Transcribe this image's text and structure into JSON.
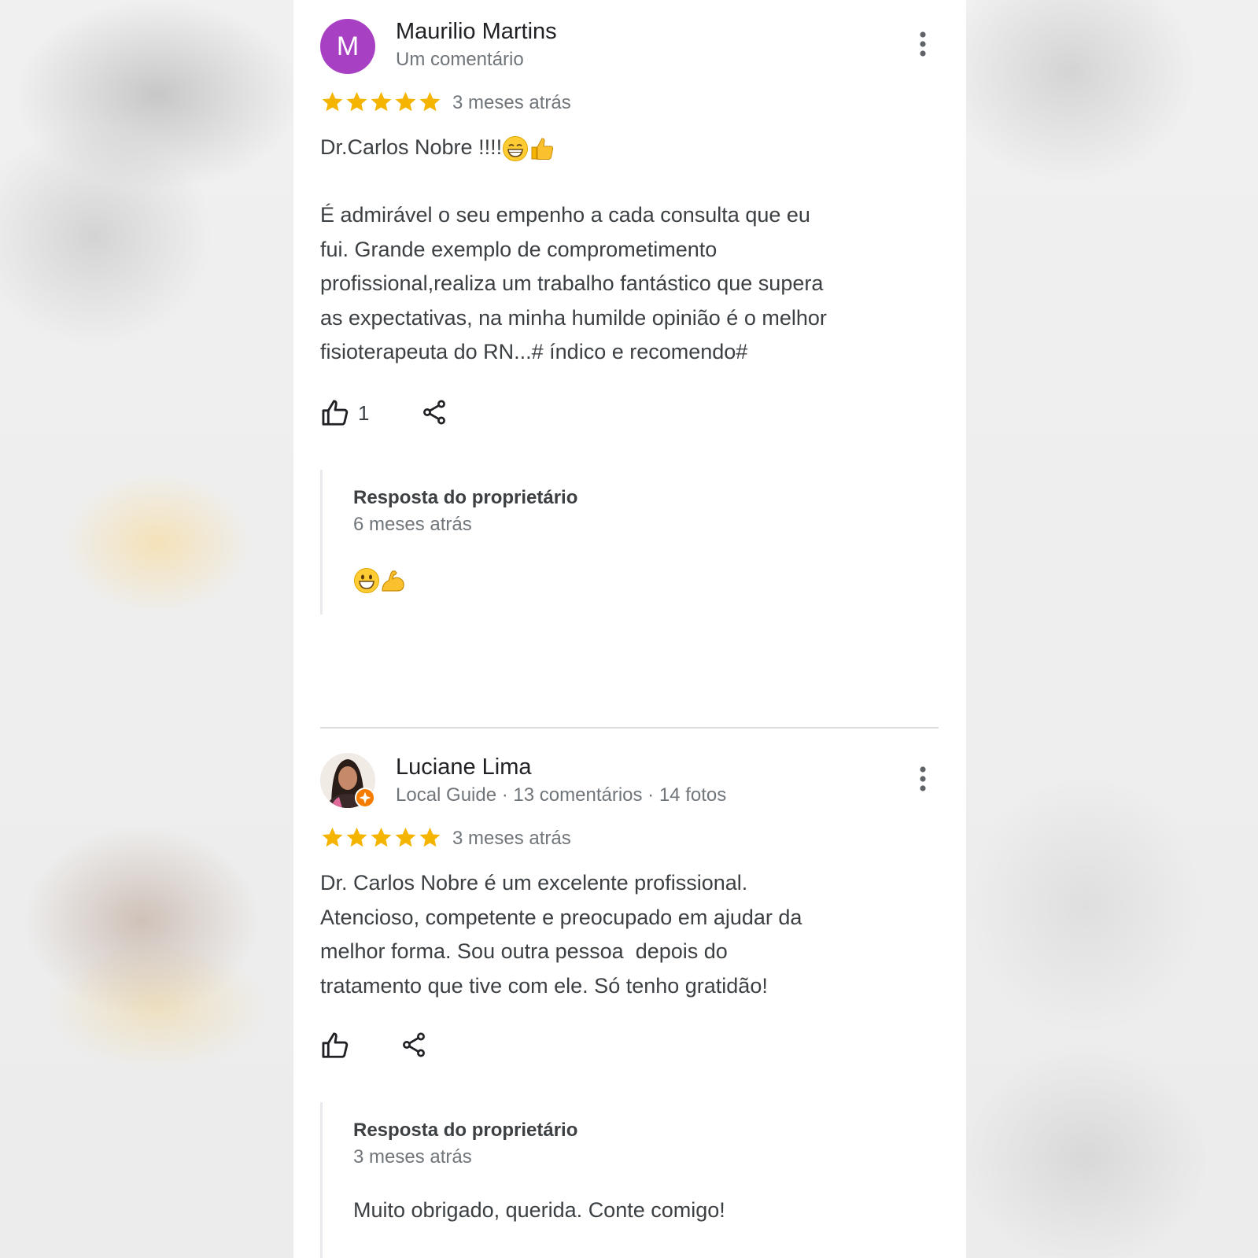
{
  "reviews": [
    {
      "avatar_letter": "M",
      "avatar_color": "#a840c4",
      "name": "Maurilio Martins",
      "meta": "Um comentário",
      "rating": 5,
      "date": "3 meses atrás",
      "text_line1": "Dr.Carlos Nobre !!!!",
      "text_line1_emojis": [
        "grinning-face-with-smiling-eyes-emoji",
        "thumbs-up-emoji"
      ],
      "text_body": "É admirável o seu empenho a cada consulta que eu\nfui. Grande exemplo de comprometimento\nprofissional,realiza um trabalho fantástico que supera\nas expectativas, na minha humilde opinião é o melhor\nfisioterapeuta do RN...# índico e recomendo#",
      "like_count": "1",
      "owner_reply": {
        "title": "Resposta do proprietário",
        "date": "6 meses atrás",
        "emojis": [
          "grinning-face-emoji",
          "flexed-biceps-emoji"
        ]
      }
    },
    {
      "avatar_badge": "local-guide-badge-icon",
      "name": "Luciane Lima",
      "meta": "Local Guide · 13 comentários · 14 fotos",
      "rating": 5,
      "date": "3 meses atrás",
      "text_body": "Dr. Carlos Nobre é um excelente profissional.\nAtencioso, competente e preocupado em ajudar da\nmelhor forma. Sou outra pessoa  depois do\ntratamento que tive com ele. Só tenho gratidão!",
      "owner_reply": {
        "title": "Resposta do proprietário",
        "date": "3 meses atrás",
        "text": "Muito obrigado, querida. Conte comigo!"
      }
    }
  ],
  "colors": {
    "star": "#f4b400",
    "text_primary": "#202124",
    "text_secondary": "#70757a",
    "text_body": "#3c4043"
  }
}
